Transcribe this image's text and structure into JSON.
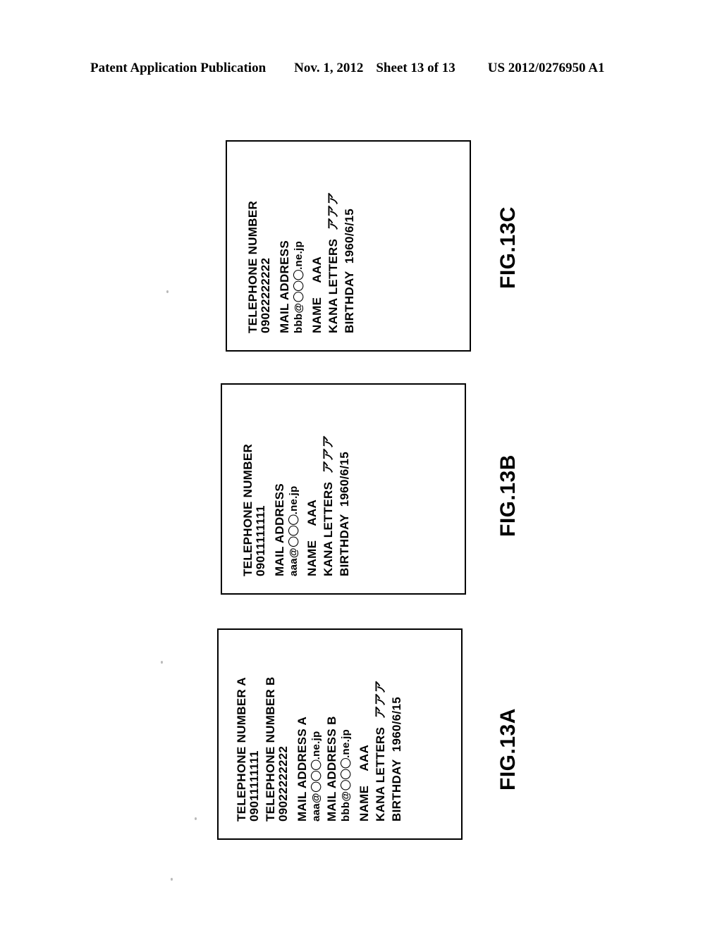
{
  "header": {
    "publication": "Patent Application Publication",
    "date": "Nov. 1, 2012",
    "sheet": "Sheet 13 of 13",
    "publication_number": "US 2012/0276950 A1"
  },
  "figures": [
    {
      "id": "fig-13c",
      "label": "FIG.13C",
      "lines": [
        "TELEPHONE NUMBER",
        "09022222222",
        "MAIL ADDRESS",
        "bbb@",
        ".ne.jp",
        "NAME    AAA",
        "KANA LETTERS",
        "BIRTHDAY  1960/6/15"
      ],
      "telephone_label": "TELEPHONE NUMBER",
      "telephone_value": "09022222222",
      "mail_label": "MAIL ADDRESS",
      "mail_user": "bbb@",
      "mail_domain": ".ne.jp",
      "mail_circles": "○○○",
      "name_label": "NAME",
      "name_value": "AAA",
      "kana_label": "KANA LETTERS",
      "kana_value": "アアア",
      "birthday_label": "BIRTHDAY",
      "birthday_value": "1960/6/15"
    },
    {
      "id": "fig-13b",
      "label": "FIG.13B",
      "telephone_label": "TELEPHONE NUMBER",
      "telephone_value": "09011111111",
      "mail_label": "MAIL ADDRESS",
      "mail_user": "aaa@",
      "mail_domain": ".ne.jp",
      "mail_circles": "○○○",
      "name_label": "NAME",
      "name_value": "AAA",
      "kana_label": "KANA LETTERS",
      "kana_value": "アアア",
      "birthday_label": "BIRTHDAY",
      "birthday_value": "1960/6/15"
    },
    {
      "id": "fig-13a",
      "label": "FIG.13A",
      "telephone_a_label": "TELEPHONE NUMBER A",
      "telephone_a_value": "09011111111",
      "telephone_b_label": "TELEPHONE NUMBER B",
      "telephone_b_value": "09022222222",
      "mail_a_label": "MAIL ADDRESS A",
      "mail_a_user": "aaa@",
      "mail_a_domain": ".ne.jp",
      "mail_b_label": "MAIL ADDRESS B",
      "mail_b_user": "bbb@",
      "mail_b_domain": ".ne.jp",
      "mail_circles": "○○○",
      "name_label": "NAME",
      "name_value": "AAA",
      "kana_label": "KANA LETTERS",
      "kana_value": "アアア",
      "birthday_label": "BIRTHDAY",
      "birthday_value": "1960/6/15"
    }
  ],
  "colors": {
    "ink": "#000000",
    "paper": "#ffffff"
  }
}
